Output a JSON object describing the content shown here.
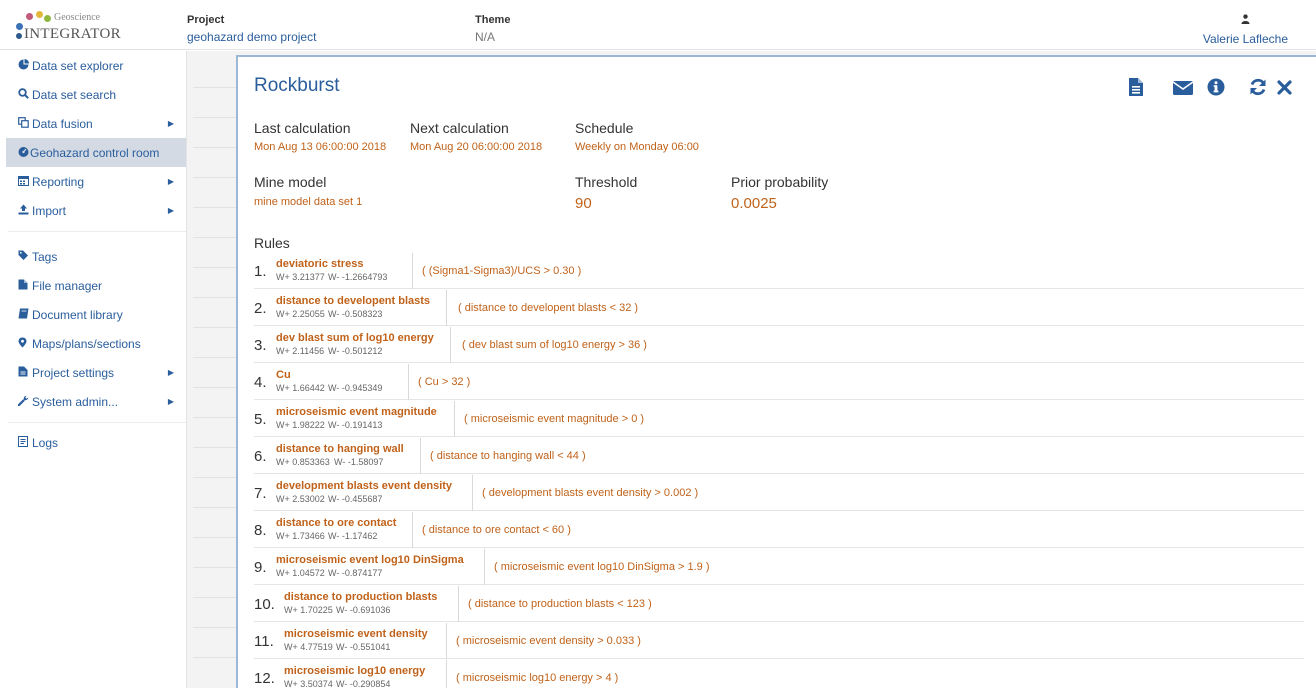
{
  "header": {
    "logo_line1": "Geoscience",
    "logo_line2": "INTEGRATOR",
    "project_label": "Project",
    "project_value": "geohazard demo project",
    "theme_label": "Theme",
    "theme_value": "N/A",
    "user_name": "Valerie Lafleche",
    "user_icon": "user-icon"
  },
  "sidebar": {
    "items": [
      {
        "label": "Data set explorer",
        "icon": "pie-chart-icon"
      },
      {
        "label": "Data set search",
        "icon": "search-icon"
      },
      {
        "label": "Data fusion",
        "icon": "copy-icon"
      },
      {
        "label": "Geohazard control room",
        "icon": "dashboard-icon"
      },
      {
        "label": "Reporting",
        "icon": "calendar-icon"
      },
      {
        "label": "Import",
        "icon": "upload-icon"
      },
      {
        "label": "Tags",
        "icon": "tags-icon"
      },
      {
        "label": "File manager",
        "icon": "file-icon"
      },
      {
        "label": "Document library",
        "icon": "book-icon"
      },
      {
        "label": "Maps/plans/sections",
        "icon": "map-marker-icon"
      },
      {
        "label": "Project settings",
        "icon": "file-settings-icon"
      },
      {
        "label": "System admin...",
        "icon": "wrench-icon"
      },
      {
        "label": "Logs",
        "icon": "log-icon"
      }
    ],
    "active_item": "Geohazard control room"
  },
  "panel": {
    "title": "Rockburst",
    "toolbar_icons": [
      "report-icon",
      "email-icon",
      "info-icon",
      "refresh-icon",
      "close-icon"
    ],
    "last_calc_label": "Last calculation",
    "last_calc_value": "Mon Aug 13 06:00:00 2018",
    "next_calc_label": "Next calculation",
    "next_calc_value": "Mon Aug 20 06:00:00 2018",
    "schedule_label": "Schedule",
    "schedule_value": "Weekly on Monday 06:00",
    "mine_model_label": "Mine model",
    "mine_model_value": "mine model data set 1",
    "threshold_label": "Threshold",
    "threshold_value": "90",
    "prior_label": "Prior probability",
    "prior_value": "0.0025",
    "rules_label": "Rules"
  },
  "rules": [
    {
      "num": "1.",
      "name": "deviatoric stress",
      "wplus": "W+ 3.21377",
      "wminus": "W- -1.2664793",
      "expr": "( (Sigma1-Sigma3)/UCS > 0.30 )"
    },
    {
      "num": "2.",
      "name": "distance to developent blasts",
      "wplus": "W+ 2.25055",
      "wminus": "W- -0.508323",
      "expr": "( distance to developent blasts < 32 )"
    },
    {
      "num": "3.",
      "name": "dev blast sum of log10 energy",
      "wplus": "W+ 2.11456",
      "wminus": "W- -0.501212",
      "expr": "( dev blast sum of log10 energy > 36 )"
    },
    {
      "num": "4.",
      "name": "Cu",
      "wplus": "W+ 1.66442",
      "wminus": "W- -0.945349",
      "expr": "( Cu > 32 )"
    },
    {
      "num": "5.",
      "name": "microseismic event magnitude",
      "wplus": "W+ 1.98222",
      "wminus": "W- -0.191413",
      "expr": "( microseismic event magnitude > 0 )"
    },
    {
      "num": "6.",
      "name": "distance to hanging wall",
      "wplus": "W+ 0.853363",
      "wminus": "W- -1.58097",
      "expr": "( distance to hanging wall < 44 )"
    },
    {
      "num": "7.",
      "name": "development blasts event density",
      "wplus": "W+ 2.53002",
      "wminus": "W- -0.455687",
      "expr": "( development blasts event density > 0.002 )"
    },
    {
      "num": "8.",
      "name": "distance to ore contact",
      "wplus": "W+ 1.73466",
      "wminus": "W- -1.17462",
      "expr": "( distance to ore contact < 60 )"
    },
    {
      "num": "9.",
      "name": "microseismic event log10 DinSigma",
      "wplus": "W+ 1.04572",
      "wminus": "W- -0.874177",
      "expr": "( microseismic event log10 DinSigma > 1.9 )"
    },
    {
      "num": "10.",
      "name": "distance to production blasts",
      "wplus": "W+ 1.70225",
      "wminus": "W- -0.691036",
      "expr": "( distance to production blasts < 123 )"
    },
    {
      "num": "11.",
      "name": "microseismic event density",
      "wplus": "W+ 4.77519",
      "wminus": "W- -0.551041",
      "expr": "( microseismic event density > 0.033 )"
    },
    {
      "num": "12.",
      "name": "microseismic log10 energy",
      "wplus": "W+ 3.50374",
      "wminus": "W- -0.290854",
      "expr": "( microseismic log10 energy > 4 )"
    }
  ],
  "colors": {
    "link_blue": "#2a5d9c",
    "accent_orange": "#c0621a",
    "active_bg": "#d4dae4"
  }
}
